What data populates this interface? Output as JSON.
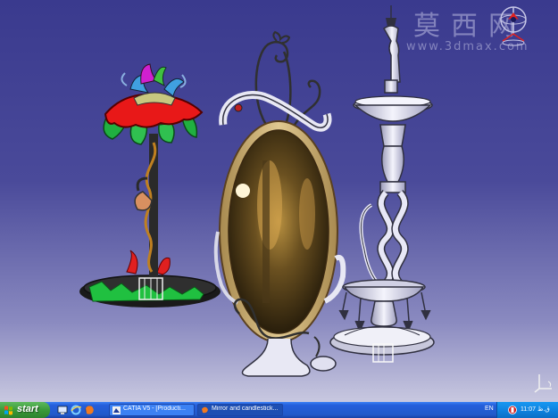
{
  "watermark": {
    "chinese": "莫西网",
    "url": "www.3dmax.com"
  },
  "viewport": {
    "background_top": "#3a3a8e",
    "background_bottom": "#c8c8e0",
    "objects": [
      "candlestick-lamp",
      "oval-mirror",
      "tall-candlestick"
    ]
  },
  "taskbar": {
    "start_label": "start",
    "quick_launch": [
      "desktop-icon",
      "ie-icon",
      "firefox-icon"
    ],
    "tasks": [
      {
        "label": "CATIA V5 - [Producti...",
        "icon": "catia-icon",
        "active": false
      },
      {
        "label": "Mirror and candlestick...",
        "icon": "firefox-icon",
        "active": true
      }
    ],
    "language": "EN",
    "clock": "11:07 ق.ظ"
  },
  "colors": {
    "taskbar_blue": "#245edb",
    "start_green": "#3a9a3a",
    "tray_blue": "#0f83e0"
  }
}
